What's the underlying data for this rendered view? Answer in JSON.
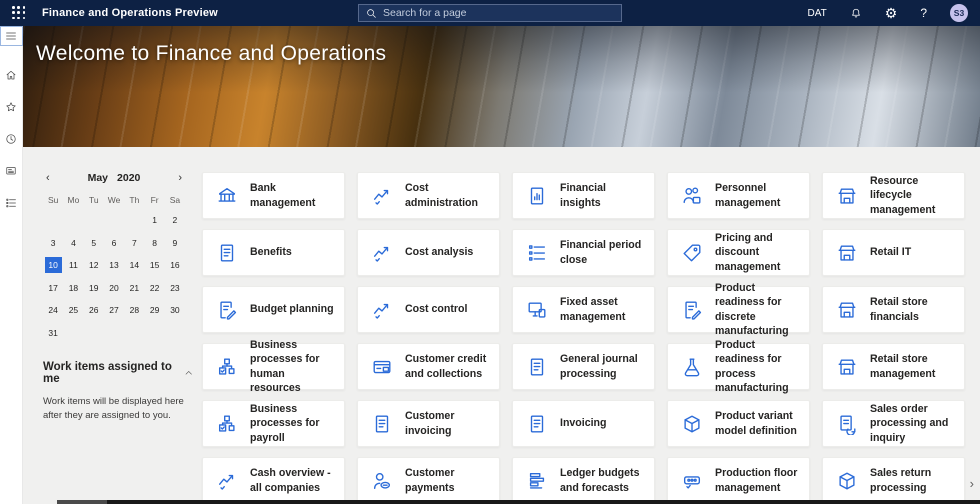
{
  "topbar": {
    "app_title": "Finance and Operations Preview",
    "search_placeholder": "Search for a page",
    "environment_label": "DAT",
    "help_label": "?",
    "avatar_initials": "S3",
    "icons": {
      "app_launcher": "waffle-grid",
      "search": "magnifier",
      "notifications": "bell",
      "settings": "gear",
      "help": "question-mark",
      "account": "avatar-circle"
    }
  },
  "sidebar": {
    "items": [
      {
        "id": "menu",
        "icon": "hamburger-icon"
      },
      {
        "id": "home",
        "icon": "home-icon"
      },
      {
        "id": "favorites",
        "icon": "star-icon"
      },
      {
        "id": "recent",
        "icon": "clock-icon"
      },
      {
        "id": "news",
        "icon": "screen-icon"
      },
      {
        "id": "modules",
        "icon": "list-tree-icon"
      }
    ]
  },
  "hero": {
    "title": "Welcome to Finance and Operations"
  },
  "calendar": {
    "month": "May",
    "year": "2020",
    "prev_glyph": "‹",
    "next_glyph": "›",
    "day_headers": [
      "Su",
      "Mo",
      "Tu",
      "We",
      "Th",
      "Fr",
      "Sa"
    ],
    "weeks": [
      [
        "",
        "",
        "",
        "",
        "",
        "1",
        "2"
      ],
      [
        "3",
        "4",
        "5",
        "6",
        "7",
        "8",
        "9"
      ],
      [
        "10",
        "11",
        "12",
        "13",
        "14",
        "15",
        "16"
      ],
      [
        "17",
        "18",
        "19",
        "20",
        "21",
        "22",
        "23"
      ],
      [
        "24",
        "25",
        "26",
        "27",
        "28",
        "29",
        "30"
      ],
      [
        "31",
        "",
        "",
        "",
        "",
        "",
        ""
      ]
    ],
    "selected_day": "10"
  },
  "work_items": {
    "title": "Work items assigned to me",
    "empty_message": "Work items will be displayed here after they are assigned to you."
  },
  "workspaces": [
    {
      "label": "Bank management",
      "icon": "bank"
    },
    {
      "label": "Benefits",
      "icon": "doc"
    },
    {
      "label": "Budget planning",
      "icon": "doc-pencil"
    },
    {
      "label": "Business processes for human resources",
      "icon": "flow"
    },
    {
      "label": "Business processes for payroll",
      "icon": "flow"
    },
    {
      "label": "Cash overview - all companies",
      "icon": "trend"
    },
    {
      "label": "Cost administration",
      "icon": "trend"
    },
    {
      "label": "Cost analysis",
      "icon": "trend"
    },
    {
      "label": "Cost control",
      "icon": "trend"
    },
    {
      "label": "Customer credit and collections",
      "icon": "card"
    },
    {
      "label": "Customer invoicing",
      "icon": "doc"
    },
    {
      "label": "Customer payments",
      "icon": "person"
    },
    {
      "label": "Financial insights",
      "icon": "doc-chart"
    },
    {
      "label": "Financial period close",
      "icon": "list"
    },
    {
      "label": "Fixed asset management",
      "icon": "devices"
    },
    {
      "label": "General journal processing",
      "icon": "doc"
    },
    {
      "label": "Invoicing",
      "icon": "doc"
    },
    {
      "label": "Ledger budgets and forecasts",
      "icon": "bars"
    },
    {
      "label": "Personnel management",
      "icon": "people"
    },
    {
      "label": "Pricing and discount management",
      "icon": "tag"
    },
    {
      "label": "Product readiness for discrete manufacturing",
      "icon": "doc-pencil"
    },
    {
      "label": "Product readiness for process manufacturing",
      "icon": "flask"
    },
    {
      "label": "Product variant model definition",
      "icon": "cube"
    },
    {
      "label": "Production floor management",
      "icon": "machine"
    },
    {
      "label": "Resource lifecycle management",
      "icon": "store"
    },
    {
      "label": "Retail IT",
      "icon": "store"
    },
    {
      "label": "Retail store financials",
      "icon": "store"
    },
    {
      "label": "Retail store management",
      "icon": "store"
    },
    {
      "label": "Sales order processing and inquiry",
      "icon": "doc-refresh"
    },
    {
      "label": "Sales return processing",
      "icon": "cube"
    }
  ],
  "scroll": {
    "right_chevron": "›"
  },
  "colors": {
    "accent_blue": "#2b6bd8",
    "topbar_navy": "#0d2144",
    "content_bg": "#f0f0ef",
    "selected_day_bg": "#2b6bd8",
    "avatar_bg": "#c6c2ec"
  }
}
